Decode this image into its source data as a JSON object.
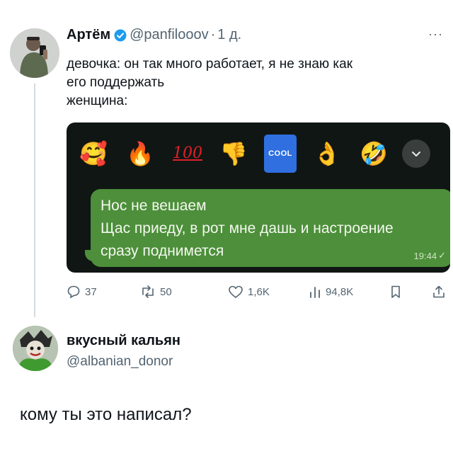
{
  "post": {
    "author_name": "Артём",
    "handle": "@panfilooov",
    "separator": "·",
    "time": "1 д.",
    "more": "···",
    "lines": [
      "девочка: он так много работает, я не знаю как",
      "его поддержать",
      "женщина:"
    ]
  },
  "telegram": {
    "reactions": [
      "🥰",
      "🔥",
      "100",
      "👎",
      "COOL",
      "👌",
      "🤣"
    ],
    "message_lines": [
      "Нос не вешаем",
      "Щас приеду, в рот мне дашь и настроение",
      "сразу поднимется"
    ],
    "message_time": "19:44",
    "message_check": "✓"
  },
  "actions": {
    "replies": "37",
    "reposts": "50",
    "likes": "1,6K",
    "views": "94,8K"
  },
  "reply": {
    "author_name": "вкусный кальян",
    "handle": "@albanian_donor",
    "text": "кому ты это написал?"
  },
  "colors": {
    "verified": "#1d9bf0",
    "message_bubble": "#4d8f3a",
    "telegram_bg": "#101613",
    "secondary_text": "#536471"
  }
}
